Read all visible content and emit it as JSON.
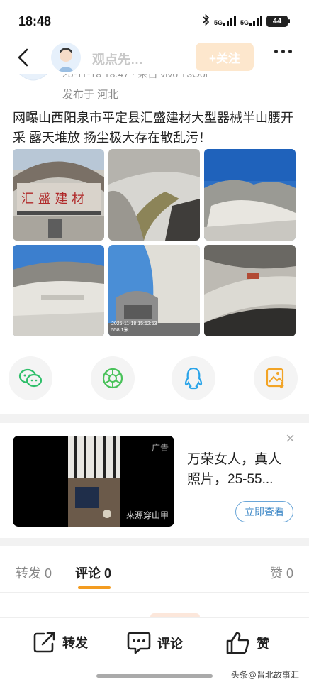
{
  "status_bar": {
    "time": "18:48",
    "network": "5G",
    "network2": "5G",
    "battery": "44"
  },
  "nav": {
    "author_name": "观点先…",
    "follow_label": "+关注"
  },
  "post": {
    "meta_partial": "25-11-18 18:47 · 来自 vivo T3Ooi",
    "location": "发布于 河北",
    "text": "网曝山西阳泉市平定县汇盛建材大型器械半山腰开采 露天堆放 扬尘极大存在散乱污！",
    "photo_stamp": "2025-11-18 15:52:53\n558.1米"
  },
  "share": {
    "items": [
      "wechat-icon",
      "moments-icon",
      "qq-icon",
      "save-image-icon"
    ]
  },
  "ad": {
    "tag": "广告",
    "source": "来源穿山甲",
    "title": "万荣女人，真人照片，25-55...",
    "cta": "立即查看",
    "close": "×"
  },
  "tabs": {
    "forward": "转发 0",
    "comment": "评论 0",
    "like": "赞 0"
  },
  "bottom_bar": {
    "forward": "转发",
    "comment": "评论",
    "like": "赞"
  },
  "watermark": "头条@晋北故事汇",
  "colors": {
    "accent": "#f39c21",
    "follow_bg": "#fde7cd",
    "cta": "#3a86c6"
  }
}
